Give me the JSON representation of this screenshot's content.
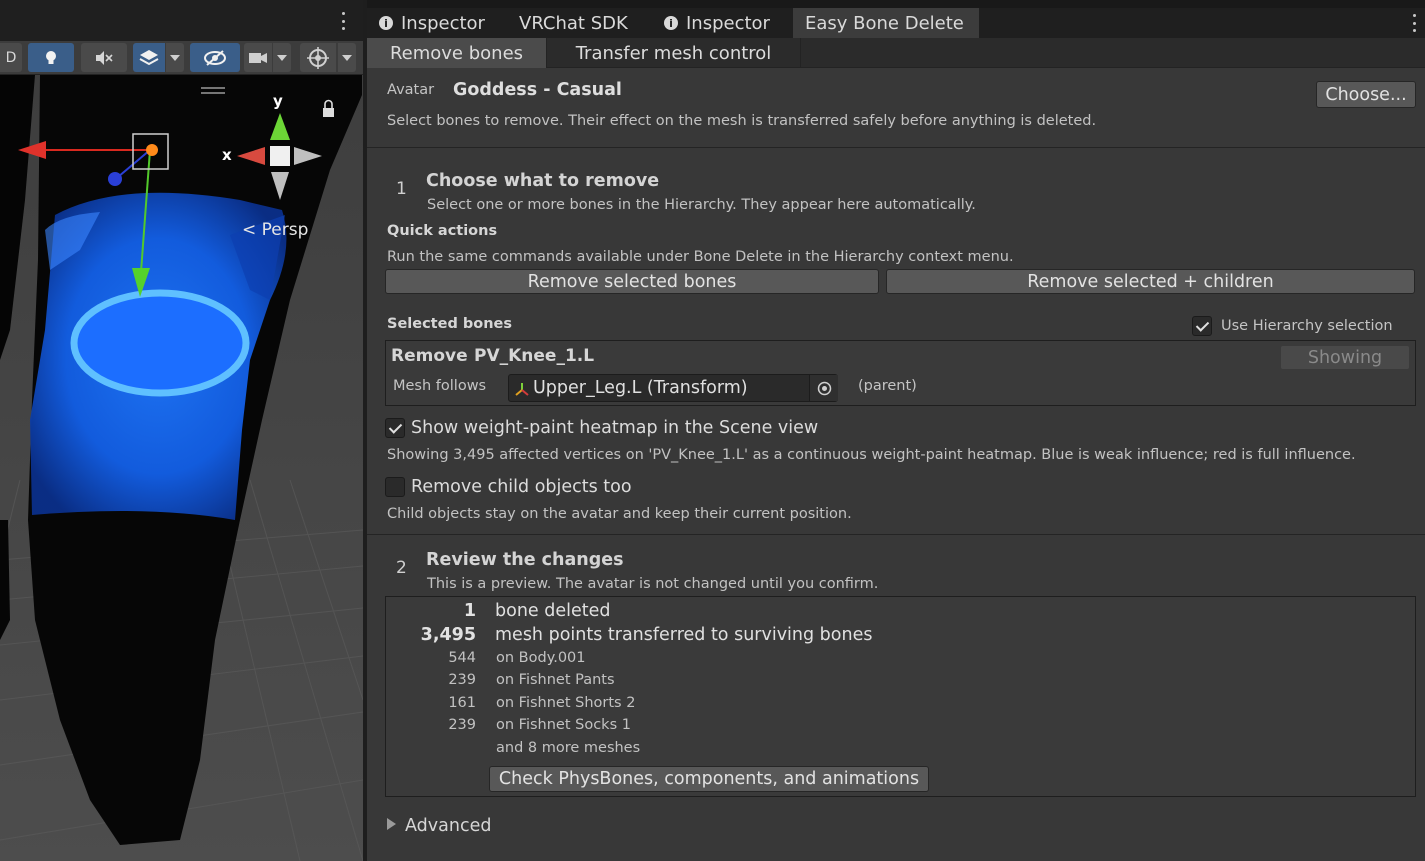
{
  "scene": {
    "persp_label": "Persp",
    "axis_x": "x",
    "axis_y": "y",
    "toolbar_label": "D"
  },
  "tabs": [
    {
      "label": "Inspector",
      "has_info_icon": true,
      "active": false
    },
    {
      "label": "VRChat SDK",
      "has_info_icon": false,
      "active": false
    },
    {
      "label": "Inspector",
      "has_info_icon": true,
      "active": false
    },
    {
      "label": "Easy Bone Delete",
      "has_info_icon": false,
      "active": true
    }
  ],
  "subtabs": [
    {
      "label": "Remove bones",
      "active": true
    },
    {
      "label": "Transfer mesh control",
      "active": false
    }
  ],
  "avatar": {
    "label": "Avatar",
    "name": "Goddess - Casual",
    "choose_button": "Choose...",
    "description": "Select bones to remove. Their effect on the mesh is transferred safely before anything is deleted."
  },
  "step1": {
    "number": "1",
    "title": "Choose what to remove",
    "subtitle": "Select one or more bones in the Hierarchy. They appear here automatically."
  },
  "quick_actions": {
    "title": "Quick actions",
    "description": "Run the same commands available under Bone Delete in the Hierarchy context menu.",
    "remove_selected": "Remove selected bones",
    "remove_selected_children": "Remove selected + children"
  },
  "selected_bones": {
    "title": "Selected bones",
    "use_hierarchy_label": "Use Hierarchy selection",
    "use_hierarchy_checked": true,
    "remove_label": "Remove",
    "bone_name": "PV_Knee_1.L",
    "showing_button": "Showing",
    "mesh_follows_label": "Mesh follows",
    "mesh_follows_value": "Upper_Leg.L (Transform)",
    "parent_note": "(parent)"
  },
  "heatmap": {
    "checked": true,
    "label": "Show weight-paint heatmap in the Scene view",
    "description": "Showing 3,495 affected vertices on 'PV_Knee_1.L' as a continuous weight-paint heatmap. Blue is weak influence; red is full influence."
  },
  "remove_children": {
    "checked": false,
    "label": "Remove child objects too",
    "description": "Child objects stay on the avatar and keep their current position."
  },
  "step2": {
    "number": "2",
    "title": "Review the changes",
    "subtitle": "This is a preview. The avatar is not changed until you confirm."
  },
  "review": {
    "bones_deleted_count": "1",
    "bones_deleted_label": "bone deleted",
    "points_count": "3,495",
    "points_label": "mesh points transferred to surviving bones",
    "meshes": [
      {
        "count": "544",
        "label": "on Body.001"
      },
      {
        "count": "239",
        "label": "on Fishnet Pants"
      },
      {
        "count": "161",
        "label": "on Fishnet Shorts 2"
      },
      {
        "count": "239",
        "label": "on Fishnet Socks 1"
      }
    ],
    "more_meshes": "and 8 more meshes",
    "check_button": "Check PhysBones, components, and animations"
  },
  "advanced": {
    "label": "Advanced"
  },
  "colors": {
    "accent_blue": "#3a5e89",
    "heatmap_blue": "#1f6cff",
    "gizmo_red": "#e0322b",
    "gizmo_green": "#55d12c",
    "gizmo_blue": "#2a3fd6"
  }
}
